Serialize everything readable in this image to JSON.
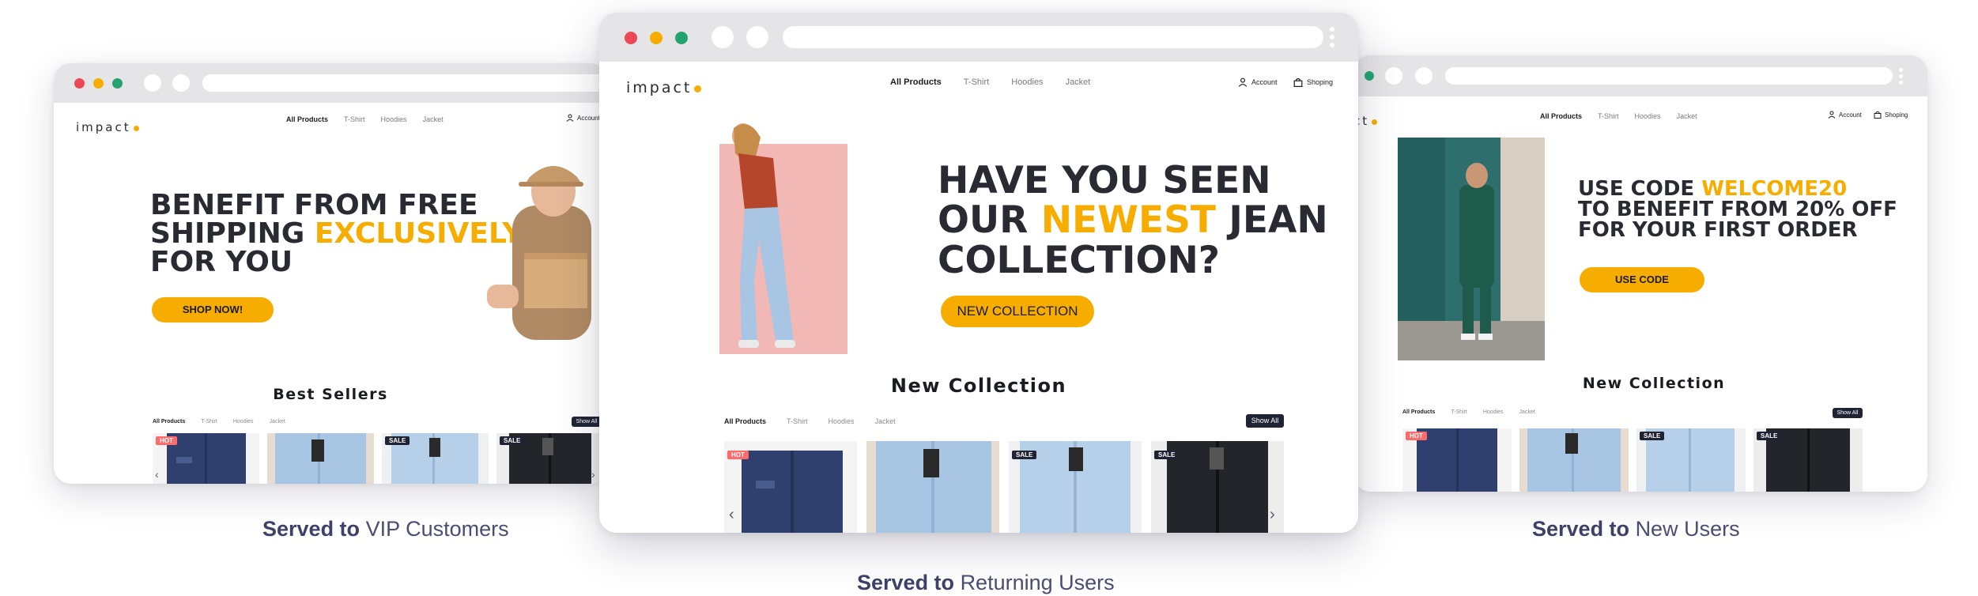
{
  "brand": {
    "logo": "impact",
    "accent": "#f7ad00",
    "dark": "#1f2333"
  },
  "nav": {
    "items": [
      "All Products",
      "T-Shirt",
      "Hoodies",
      "Jacket"
    ],
    "account": "Account",
    "shopping": "Shoping"
  },
  "left": {
    "hero_line1": "BENEFIT FROM FREE",
    "hero_line2_a": "SHIPPING ",
    "hero_line2_b": "EXCLUSIVELY",
    "hero_line3": "FOR YOU",
    "cta": "SHOP NOW!",
    "section_title": "Best Sellers",
    "tabs": [
      "All Products",
      "T-Shirt",
      "Hoodies",
      "Jacket"
    ],
    "show_all": "Show All",
    "badges": [
      "HOT",
      "",
      "SALE",
      "SALE"
    ]
  },
  "center": {
    "hero_line1": "HAVE YOU SEEN",
    "hero_line2_a": "OUR ",
    "hero_line2_b": "NEWEST",
    "hero_line2_c": " JEAN",
    "hero_line3": "COLLECTION?",
    "cta": "NEW COLLECTION",
    "section_title": "New Collection",
    "tabs": [
      "All Products",
      "T-Shirt",
      "Hoodies",
      "Jacket"
    ],
    "show_all": "Show All",
    "badges": [
      "HOT",
      "",
      "SALE",
      "SALE"
    ]
  },
  "right": {
    "hero_line1_a": "USE CODE ",
    "hero_line1_b": "WELCOME20",
    "hero_line2": "TO BENEFIT FROM 20% OFF",
    "hero_line3": "FOR YOUR FIRST ORDER",
    "cta": "USE CODE",
    "section_title": "New Collection",
    "tabs": [
      "All Products",
      "T-Shirt",
      "Hoodies",
      "Jacket"
    ],
    "show_all": "Show All",
    "badges": [
      "HOT",
      "",
      "SALE",
      "SALE"
    ]
  },
  "captions": {
    "left": {
      "bold": "Served to",
      "rest": "VIP Customers"
    },
    "center": {
      "bold": "Served to",
      "rest": "Returning Users"
    },
    "right": {
      "bold": "Served to",
      "rest": "New Users"
    }
  },
  "colors": {
    "red": "#ed4655",
    "yellow": "#f7ad00",
    "green": "#25a36f",
    "hot": "#ff6b6b",
    "jean_dark": "#2f3f6e",
    "jean_light": "#a8c6e4",
    "jean_mid": "#6f8fc2",
    "jean_black": "#23252b"
  }
}
